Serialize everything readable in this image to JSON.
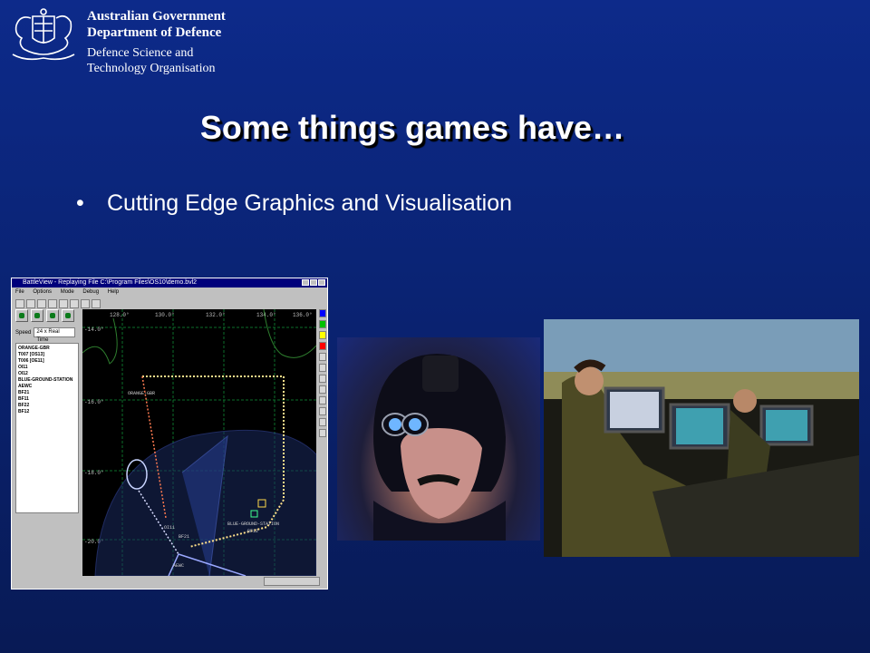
{
  "header": {
    "org_line1": "Australian Government",
    "org_line2": "Department of Defence",
    "org_line3": "Defence Science and",
    "org_line4": "Technology Organisation"
  },
  "slide": {
    "title": "Some things games have…",
    "bullet": "Cutting Edge Graphics and Visualisation"
  },
  "screenshot": {
    "window_title": "BattleView - Replaying File C:\\Program Files\\OS10\\demo.bvl2",
    "menu": [
      "File",
      "Options",
      "Mode",
      "Debug",
      "Help"
    ],
    "speed_label": "Speed",
    "speed_value": "24 x Real Time",
    "entities": [
      "ORANGE-GBR",
      "T007 [OS13]",
      "T006 [OE11]",
      "OI11",
      "OI12",
      "BLUE-GROUND-STATION",
      "AEWC",
      "BF21",
      "BF11",
      "BF22",
      "BF12"
    ],
    "lon_labels": [
      "128.0°",
      "130.0°",
      "132.0°",
      "134.0°",
      "136.0°"
    ],
    "lat_labels": [
      "-14.0°",
      "-16.0°",
      "-18.0°",
      "-20.0°"
    ],
    "map_labels": {
      "orange": "ORANGE-GBR",
      "station": "BLUE-GROUND-STATION",
      "bf": "BF12",
      "bf21": "BF21",
      "aewc": "AEWC",
      "oi": "OI11"
    },
    "colors": {
      "palette": [
        "#0000ff",
        "#00c000",
        "#ffff00",
        "#ff0000"
      ]
    }
  },
  "photos": {
    "nvg_alt": "soldier-wearing-night-vision-goggles",
    "sim_alt": "operators-at-simulation-consoles"
  }
}
